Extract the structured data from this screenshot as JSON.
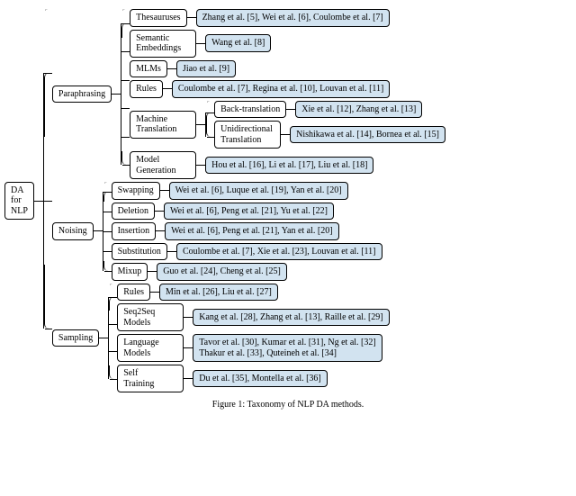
{
  "root": "DA\nfor\nNLP",
  "caption": "Figure 1: Taxonomy of NLP DA methods.",
  "categories": [
    {
      "name": "Paraphrasing",
      "children": [
        {
          "name": "Thesauruses",
          "refs": "Zhang et al. [5], Wei et al. [6], Coulombe et al. [7]"
        },
        {
          "name": "Semantic\nEmbeddings",
          "refs": "Wang et al. [8]"
        },
        {
          "name": "MLMs",
          "refs": "Jiao et al. [9]"
        },
        {
          "name": "Rules",
          "refs": "Coulombe et al. [7], Regina et al. [10], Louvan et al. [11]"
        },
        {
          "name": "Machine\nTranslation",
          "children": [
            {
              "name": "Back-translation",
              "refs": "Xie et al. [12], Zhang et al. [13]"
            },
            {
              "name": "Unidirectional\nTranslation",
              "refs": "Nishikawa et al. [14], Bornea et al. [15]"
            }
          ]
        },
        {
          "name": "Model\nGeneration",
          "refs": "Hou et al. [16], Li et al. [17], Liu et al. [18]"
        }
      ]
    },
    {
      "name": "Noising",
      "children": [
        {
          "name": "Swapping",
          "refs": "Wei et al. [6], Luque et al. [19], Yan et al. [20]"
        },
        {
          "name": "Deletion",
          "refs": "Wei et al. [6], Peng et al. [21], Yu et al. [22]"
        },
        {
          "name": "Insertion",
          "refs": "Wei et al. [6], Peng et al. [21], Yan et al. [20]"
        },
        {
          "name": "Substitution",
          "refs": "Coulombe et al. [7], Xie et al. [23], Louvan et al. [11]"
        },
        {
          "name": "Mixup",
          "refs": "Guo et al. [24], Cheng et al. [25]"
        }
      ]
    },
    {
      "name": "Sampling",
      "children": [
        {
          "name": "Rules",
          "refs": "Min et al. [26], Liu et al. [27]"
        },
        {
          "name": "Seq2Seq\nModels",
          "refs": "Kang et al. [28], Zhang et al. [13], Raille et al.  [29]"
        },
        {
          "name": "Language\nModels",
          "refs": "Tavor et al. [30], Kumar et al. [31], Ng et al. [32]\nThakur et al. [33], Quteineh et al. [34]"
        },
        {
          "name": "Self\nTraining",
          "refs": "Du et al. [35], Montella et al. [36]"
        }
      ]
    }
  ]
}
